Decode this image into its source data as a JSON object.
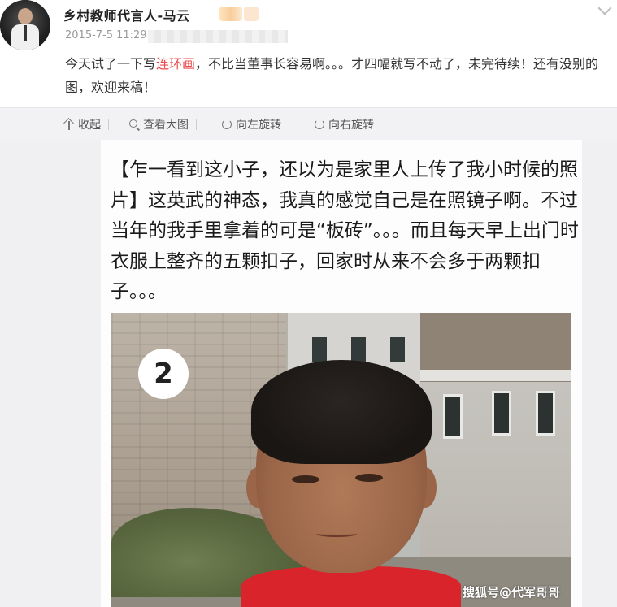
{
  "post": {
    "username": "乡村教师代言人-马云",
    "timestamp": "2015-7-5 11:29",
    "text_before": "今天试了一下写",
    "text_link": "连环画",
    "text_after": "，不比当董事长容易啊。。。才四幅就写不动了，未完待续！还有没别的图，欢迎来稿！"
  },
  "toolbar": {
    "collapse": "收起",
    "view_large": "查看大图",
    "rotate_left": "向左旋转",
    "rotate_right": "向右旋转"
  },
  "card": {
    "caption": "【乍一看到这小子，还以为是家里人上传了我小时候的照片】这英武的神态，我真的感觉自己是在照镜子啊。不过当年的我手里拿着的可是“板砖”。。。而且每天早上出门时衣服上整齐的五颗扣子，回家时从来不会多于两颗扣子。。。",
    "badge_number": "2"
  },
  "watermark": "搜狐号@代军哥哥",
  "colors": {
    "link": "#eb4d4d",
    "toolbar_bg": "#f2f2f5",
    "shirt": "#d8242a"
  }
}
